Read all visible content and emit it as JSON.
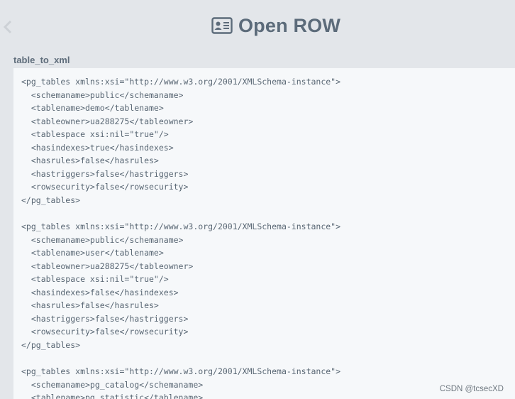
{
  "header": {
    "title": "Open ROW",
    "icon": "id-card-icon",
    "back_icon": "chevron-left-icon"
  },
  "section": {
    "label": "table_to_xml"
  },
  "xml_lines": [
    "<pg_tables xmlns:xsi=\"http://www.w3.org/2001/XMLSchema-instance\">",
    "  <schemaname>public</schemaname>",
    "  <tablename>demo</tablename>",
    "  <tableowner>ua288275</tableowner>",
    "  <tablespace xsi:nil=\"true\"/>",
    "  <hasindexes>true</hasindexes>",
    "  <hasrules>false</hasrules>",
    "  <hastriggers>false</hastriggers>",
    "  <rowsecurity>false</rowsecurity>",
    "</pg_tables>",
    "",
    "<pg_tables xmlns:xsi=\"http://www.w3.org/2001/XMLSchema-instance\">",
    "  <schemaname>public</schemaname>",
    "  <tablename>user</tablename>",
    "  <tableowner>ua288275</tableowner>",
    "  <tablespace xsi:nil=\"true\"/>",
    "  <hasindexes>false</hasindexes>",
    "  <hasrules>false</hasrules>",
    "  <hastriggers>false</hastriggers>",
    "  <rowsecurity>false</rowsecurity>",
    "</pg_tables>",
    "",
    "<pg_tables xmlns:xsi=\"http://www.w3.org/2001/XMLSchema-instance\">",
    "  <schemaname>pg_catalog</schemaname>",
    "  <tablename>pg_statistic</tablename>"
  ],
  "watermark": "CSDN @tcsecXD",
  "colors": {
    "background": "#e3e6ea",
    "code_background": "#f6f8fa",
    "title": "#5c6b7a",
    "code_text": "#586673"
  }
}
